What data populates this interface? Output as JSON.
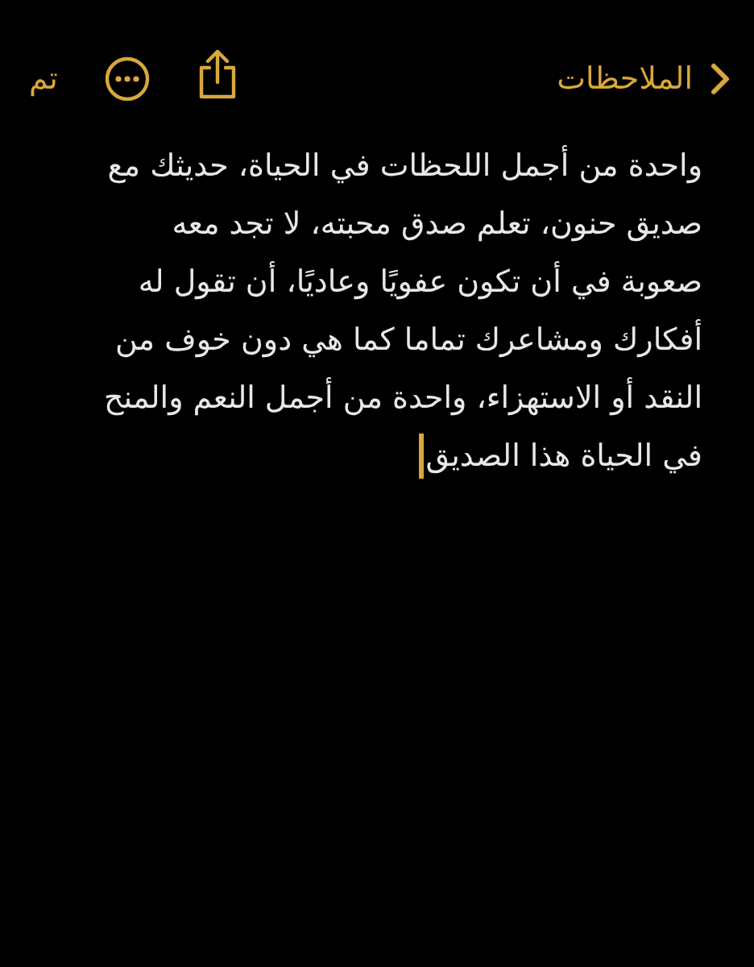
{
  "nav_bar": {
    "back_label": "الملاحظات",
    "done_label": "تم"
  },
  "note": {
    "lines": [
      "واحدة من أجمل اللحظات في الحياة، حديثك مع",
      "صديق حنون، تعلم صدق محبته، لا تجد معه",
      "صعوبة في أن تكون عفويًا وعاديًا، أن تقول له",
      "أفكارك ومشاعرك تماما كما هي دون خوف من",
      "النقد أو الاستهزاء، واحدة من أجمل النعم والمنح",
      "في الحياة هذا الصديق"
    ],
    "cursor_visible": true
  }
}
